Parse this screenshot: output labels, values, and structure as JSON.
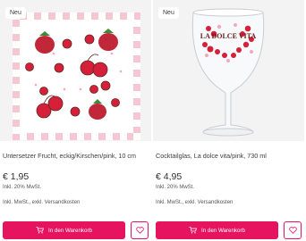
{
  "products": [
    {
      "badge": "Neu",
      "title": "Untersetzer Frucht, eckig/Kirschen/pink, 10 cm",
      "price": "€ 1,95",
      "vat": "Inkl. 20% MwSt.",
      "shipping": "Inkl. MwSt., exkl. Versandkosten",
      "cart_label": "In den Warenkorb",
      "cart_icon": "shopping-cart-icon",
      "wishlist_icon": "heart-icon"
    },
    {
      "badge": "Neu",
      "title": "Cocktailglas, La dolce vita/pink, 730 ml",
      "price": "€ 4,95",
      "vat": "Inkl. 20% MwSt.",
      "shipping": "Inkl. MwSt., exkl. Versandkosten",
      "cart_label": "In den Warenkorb",
      "cart_icon": "shopping-cart-icon",
      "wishlist_icon": "heart-icon",
      "glass_print": "LA DOLCE VITA"
    }
  ],
  "colors": {
    "accent": "#e6135f",
    "image_bg": "#f3f3f3"
  }
}
